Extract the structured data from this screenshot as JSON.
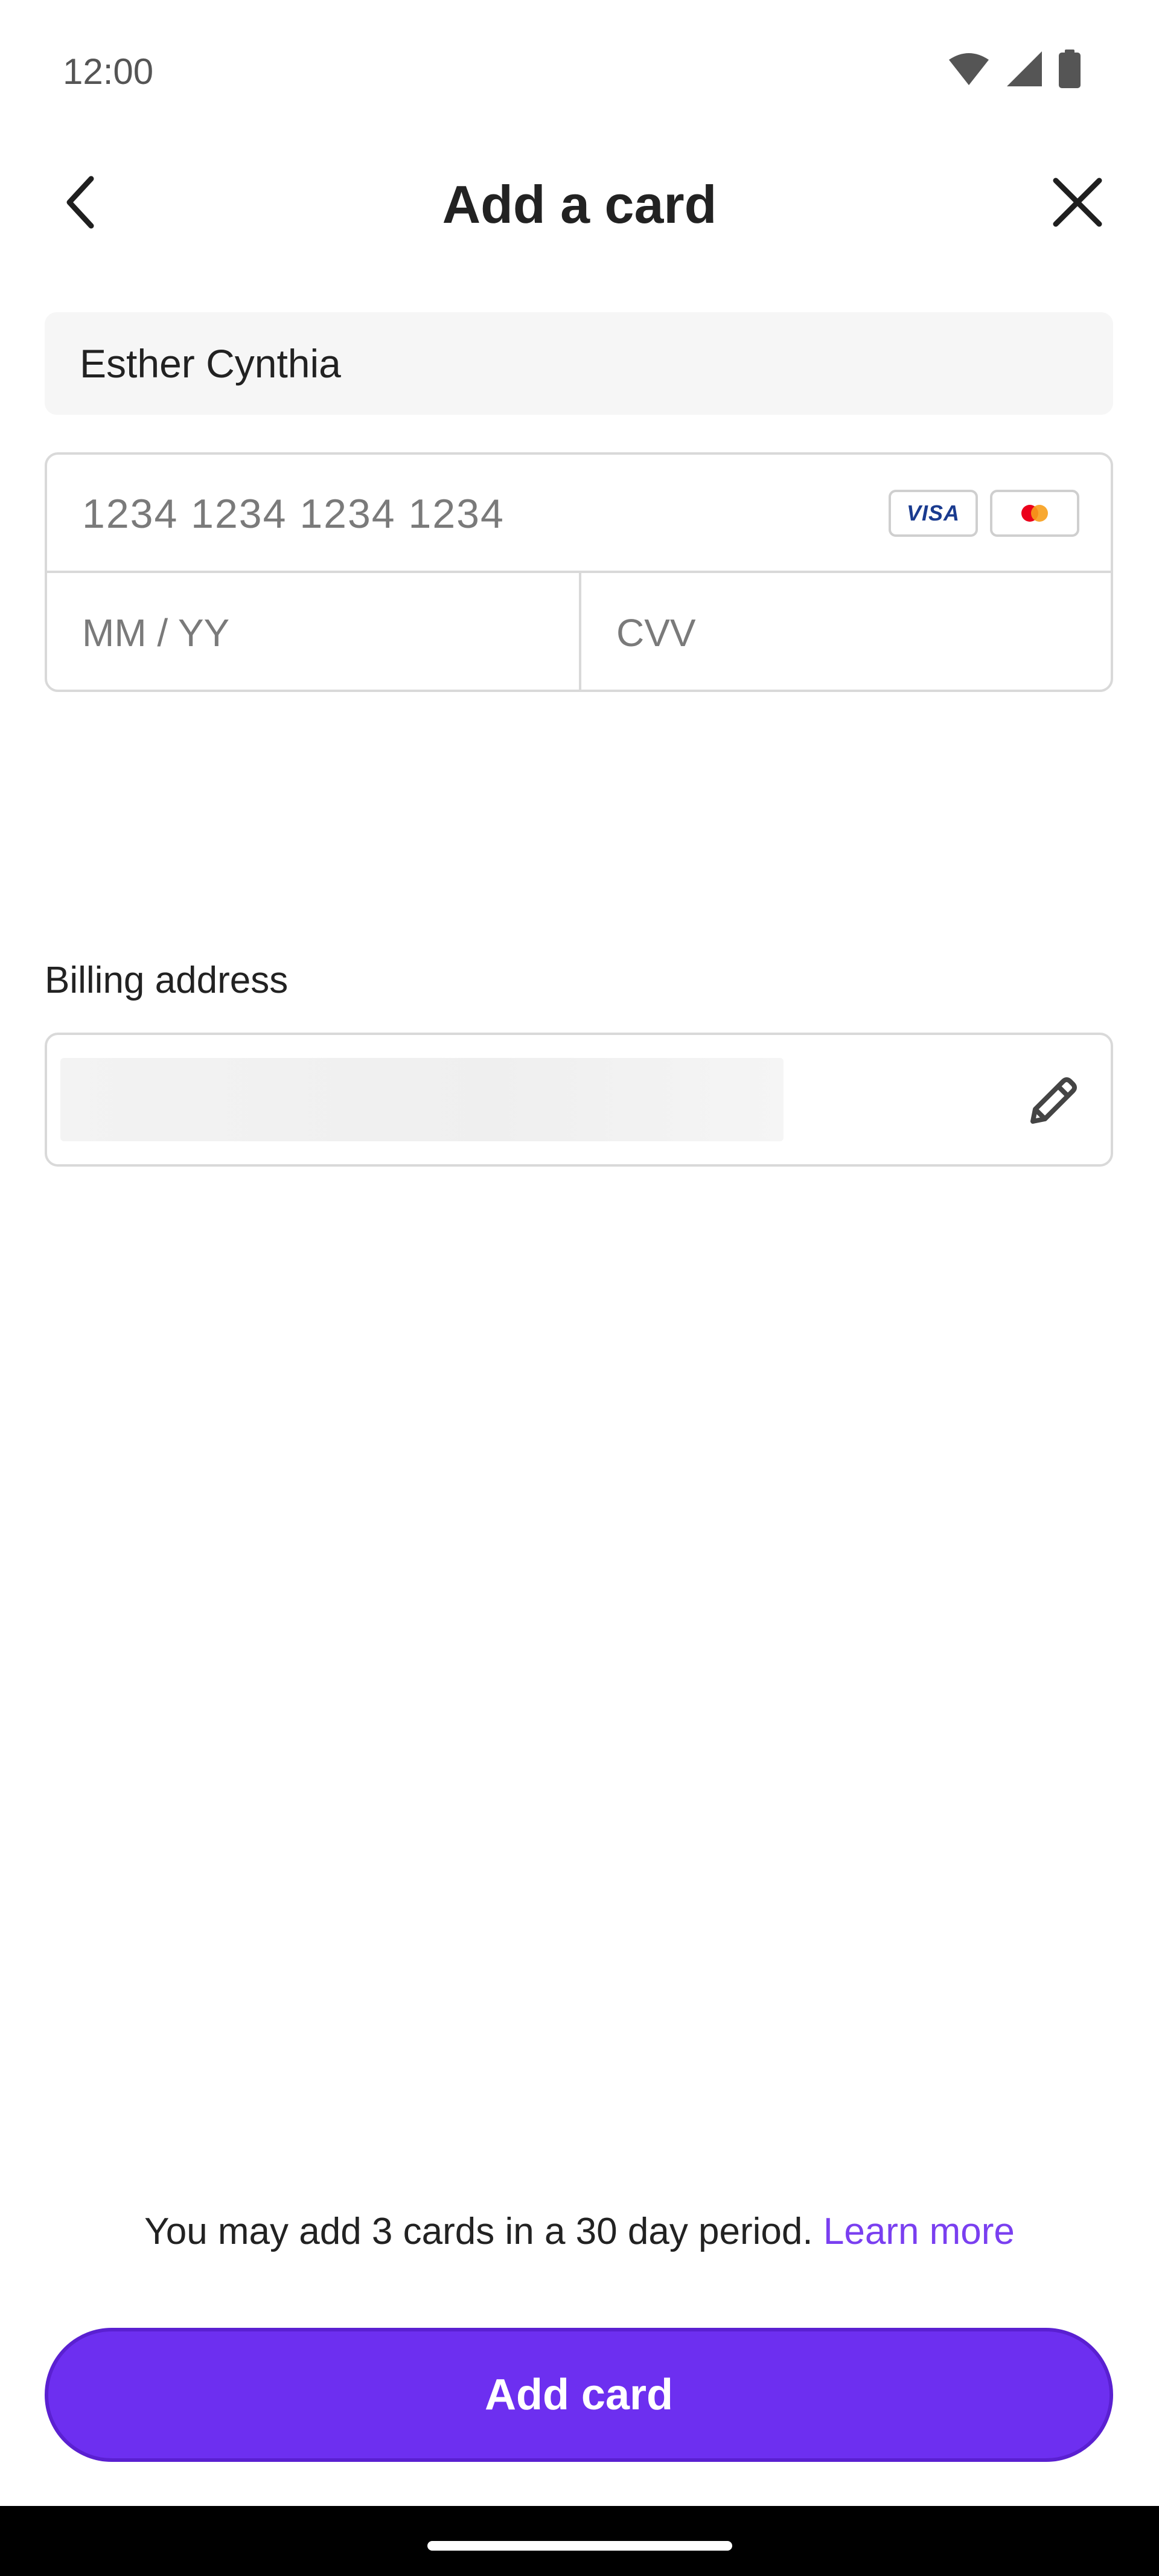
{
  "status_bar": {
    "time": "12:00",
    "icons": [
      "wifi-icon",
      "cellular-signal-icon",
      "battery-icon"
    ]
  },
  "header": {
    "title": "Add a card",
    "back_icon": "chevron-left-icon",
    "close_icon": "close-icon"
  },
  "form": {
    "cardholder_name": "Esther Cynthia",
    "card_number_placeholder": "1234 1234 1234 1234",
    "expiry_placeholder": "MM / YY",
    "cvv_placeholder": "CVV",
    "brands": [
      {
        "name": "VISA",
        "icon": "visa-logo-icon"
      },
      {
        "name": "Mastercard",
        "icon": "mastercard-logo-icon"
      }
    ]
  },
  "billing": {
    "label": "Billing address",
    "edit_icon": "pencil-icon"
  },
  "footer": {
    "notice": "You may add 3 cards in a 30 day period.",
    "learn_more": "Learn more",
    "submit_label": "Add card"
  },
  "colors": {
    "accent": "#6d2ff0",
    "link": "#7a3ff0",
    "visa_blue": "#1a3b8f",
    "mastercard_red": "#eb001b",
    "mastercard_orange": "#f79e1b"
  }
}
